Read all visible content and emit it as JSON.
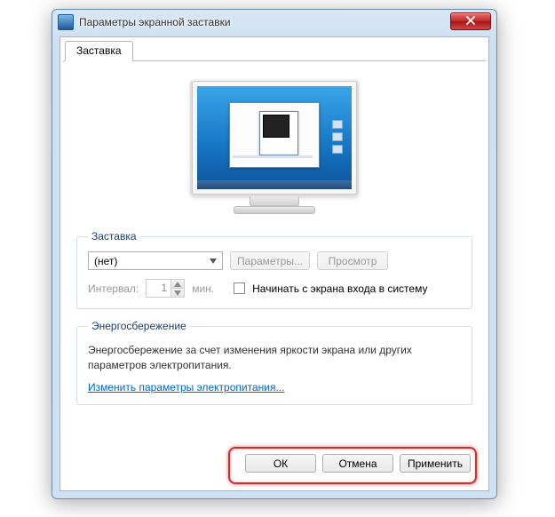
{
  "window": {
    "title": "Параметры экранной заставки"
  },
  "tabs": {
    "screensaver": "Заставка"
  },
  "group_screensaver": {
    "legend": "Заставка",
    "selected": "(нет)",
    "settings_btn": "Параметры...",
    "preview_btn": "Просмотр",
    "interval_label": "Интервал:",
    "interval_value": "1",
    "minutes_label": "мин.",
    "resume_checkbox_label": "Начинать с экрана входа в систему"
  },
  "group_power": {
    "legend": "Энергосбережение",
    "description": "Энергосбережение за счет изменения яркости экрана или других параметров электропитания.",
    "link": "Изменить параметры электропитания..."
  },
  "buttons": {
    "ok": "ОК",
    "cancel": "Отмена",
    "apply": "Применить"
  }
}
